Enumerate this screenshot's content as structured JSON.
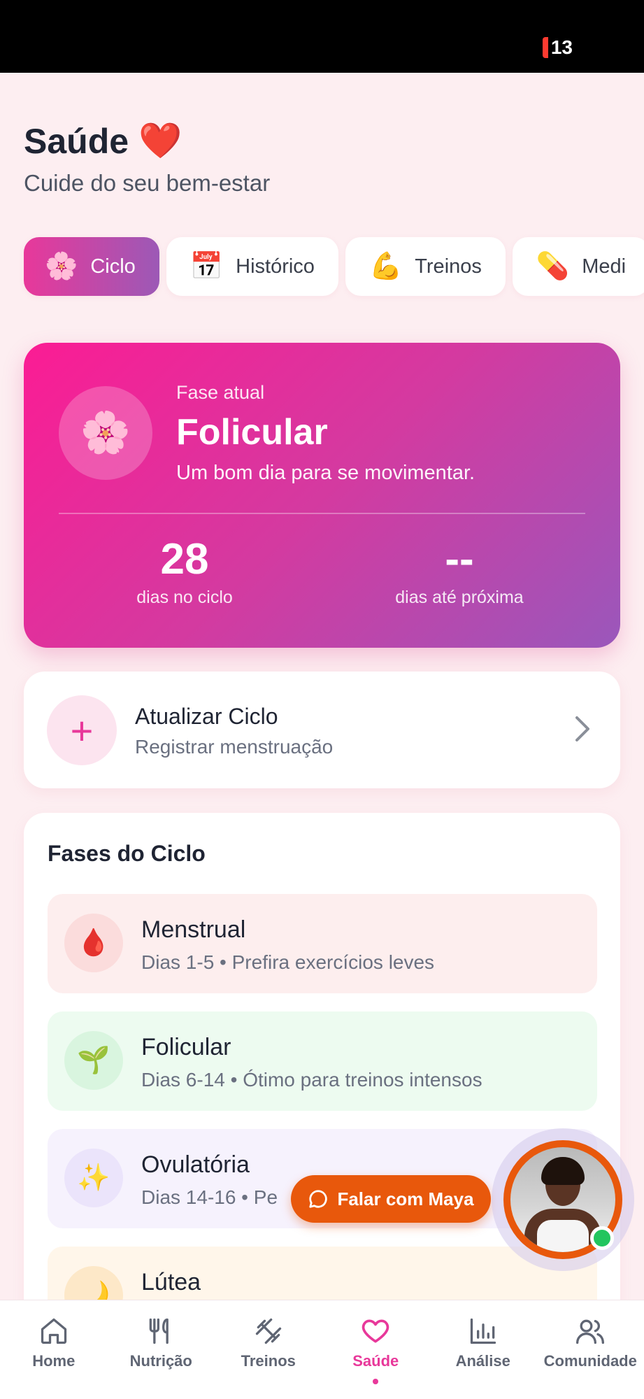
{
  "status_bar": {
    "battery": "13"
  },
  "header": {
    "title": "Saúde",
    "title_emoji": "❤️",
    "subtitle": "Cuide do seu bem-estar"
  },
  "tabs": [
    {
      "emoji": "🌸",
      "label": "Ciclo",
      "active": true
    },
    {
      "emoji": "📅",
      "label": "Histórico"
    },
    {
      "emoji": "💪",
      "label": "Treinos"
    },
    {
      "emoji": "💊",
      "label": "Medi"
    }
  ],
  "current_phase": {
    "emoji": "🌸",
    "label": "Fase atual",
    "name": "Folicular",
    "tip": "Um bom dia para se movimentar.",
    "days_in_cycle": "28",
    "days_in_cycle_label": "dias no ciclo",
    "days_until_next": "--",
    "days_until_next_label": "dias até próxima"
  },
  "update_cycle": {
    "title": "Atualizar Ciclo",
    "subtitle": "Registrar menstruação"
  },
  "phases": {
    "title": "Fases do Ciclo",
    "items": [
      {
        "emoji": "🩸",
        "name": "Menstrual",
        "desc": "Dias 1-5 • Prefira exercícios leves"
      },
      {
        "emoji": "🌱",
        "name": "Folicular",
        "desc": "Dias 6-14 • Ótimo para treinos intensos"
      },
      {
        "emoji": "✨",
        "name": "Ovulatória",
        "desc": "Dias 14-16 • Pe"
      },
      {
        "emoji": "🌙",
        "name": "Lútea",
        "desc": ""
      }
    ]
  },
  "maya": {
    "button_label": "Falar com Maya"
  },
  "bottom_nav": [
    {
      "label": "Home",
      "icon": "home-icon"
    },
    {
      "label": "Nutrição",
      "icon": "utensils-icon"
    },
    {
      "label": "Treinos",
      "icon": "dumbbell-icon"
    },
    {
      "label": "Saúde",
      "icon": "heart-icon",
      "active": true
    },
    {
      "label": "Análise",
      "icon": "bar-chart-icon"
    },
    {
      "label": "Comunidade",
      "icon": "users-icon"
    }
  ],
  "colors": {
    "primary_pink": "#e8389a",
    "gradient_start": "#fb1c94",
    "gradient_end": "#9a57bb",
    "maya_orange": "#e8580c",
    "online_green": "#22c55e"
  }
}
